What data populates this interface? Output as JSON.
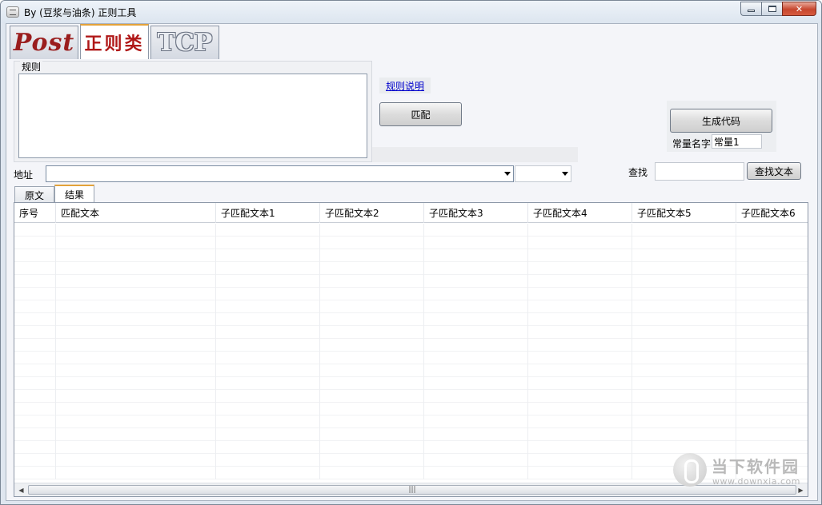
{
  "window": {
    "title": "By (豆浆与油条) 正则工具"
  },
  "top_tabs": [
    {
      "label": "Post"
    },
    {
      "label": "正则类"
    },
    {
      "label": "TCP"
    }
  ],
  "rule_group": {
    "legend": "规则",
    "value": ""
  },
  "help_link": "规则说明",
  "match_button": "匹配",
  "generate_button": "生成代码",
  "constant": {
    "label": "常量名字",
    "value": "常量1"
  },
  "address": {
    "label": "地址",
    "value": ""
  },
  "encoding": {
    "value": ""
  },
  "find": {
    "label": "查找",
    "value": "",
    "button": "查找文本"
  },
  "result_tabs": [
    {
      "label": "原文"
    },
    {
      "label": "结果"
    }
  ],
  "grid": {
    "columns": [
      "序号",
      "匹配文本",
      "子匹配文本1",
      "子匹配文本2",
      "子匹配文本3",
      "子匹配文本4",
      "子匹配文本5",
      "子匹配文本6"
    ]
  },
  "watermark": {
    "title": "当下软件园",
    "url": "www.downxia.com"
  },
  "icons": {
    "app": "app-icon",
    "minimize": "minimize-icon",
    "maximize": "maximize-icon",
    "close": "close-icon",
    "dropdown": "chevron-down-icon"
  }
}
